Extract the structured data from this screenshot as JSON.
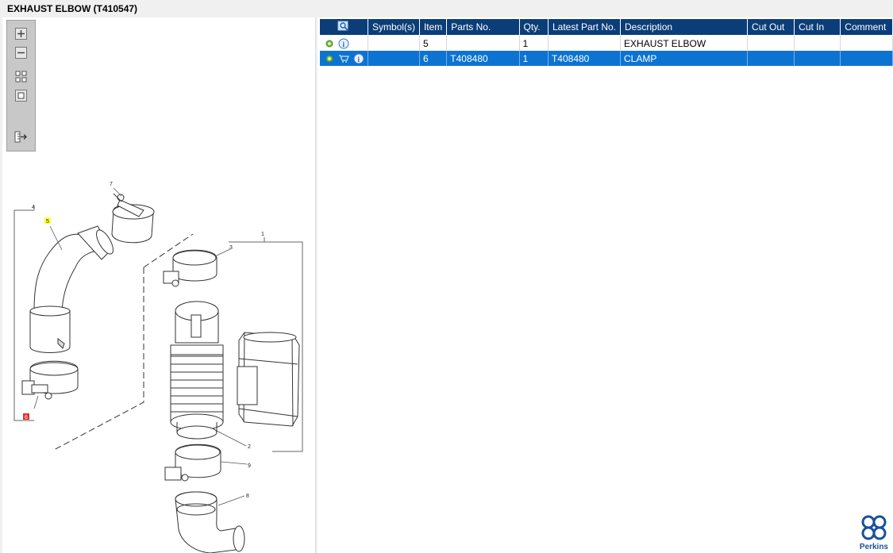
{
  "window": {
    "title": "EXHAUST ELBOW (T410547)"
  },
  "toolbox": {
    "icons": [
      "zoom-in-icon",
      "zoom-out-icon",
      "fit-page-icon",
      "actual-size-icon",
      "export-icon"
    ]
  },
  "drawing": {
    "callouts": [
      "4",
      "5",
      "7",
      "1",
      "3",
      "2",
      "9",
      "8",
      "6"
    ],
    "highlight_color": "#ffff33",
    "selected_color": "#e03030"
  },
  "table": {
    "headers": [
      "Symbol(s)",
      "Item",
      "Parts No.",
      "Qty.",
      "Latest Part No.",
      "Description",
      "Cut Out",
      "Cut In",
      "Comment"
    ],
    "rows": [
      {
        "item": "5",
        "parts_no": "",
        "qty": "1",
        "latest_part_no": "",
        "description": "EXHAUST ELBOW",
        "cut_out": "",
        "cut_in": "",
        "comment": ""
      },
      {
        "item": "6",
        "parts_no": "T408480",
        "qty": "1",
        "latest_part_no": "T408480",
        "description": "CLAMP",
        "cut_out": "",
        "cut_in": "",
        "comment": ""
      }
    ]
  },
  "colors": {
    "header_bg": "#0b3e79",
    "selected_row": "#0c73d2",
    "brand": "#1c4f9c"
  },
  "brand": {
    "name": "Perkins"
  }
}
